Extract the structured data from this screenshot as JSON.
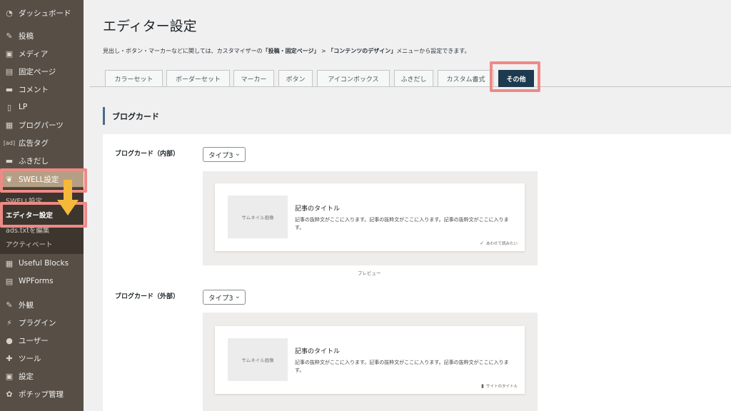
{
  "sidebar": {
    "items": [
      {
        "label": "ダッシュボード",
        "icon": "dashboard-icon",
        "glyph": "◔"
      },
      {
        "label": "投稿",
        "icon": "pin-icon",
        "glyph": "✎"
      },
      {
        "label": "メディア",
        "icon": "media-icon",
        "glyph": "▣"
      },
      {
        "label": "固定ページ",
        "icon": "page-icon",
        "glyph": "▤"
      },
      {
        "label": "コメント",
        "icon": "comment-icon",
        "glyph": "▬"
      },
      {
        "label": "LP",
        "icon": "file-icon",
        "glyph": "▯"
      },
      {
        "label": "ブログパーツ",
        "icon": "grid-icon",
        "glyph": "▦"
      },
      {
        "label": "広告タグ",
        "icon": "ad-icon",
        "glyph": "[ad]"
      },
      {
        "label": "ふきだし",
        "icon": "speech-icon",
        "glyph": "▬"
      },
      {
        "label": "SWELL設定",
        "icon": "swell-leaf-icon",
        "glyph": "❦"
      }
    ],
    "submenu": [
      "SWELL設定",
      "エディター設定",
      "ads.txtを編集",
      "アクティベート"
    ],
    "items2": [
      {
        "label": "Useful Blocks",
        "icon": "blocks-icon",
        "glyph": "▦"
      },
      {
        "label": "WPForms",
        "icon": "forms-icon",
        "glyph": "▤"
      },
      {
        "label": "外観",
        "icon": "brush-icon",
        "glyph": "✎"
      },
      {
        "label": "プラグイン",
        "icon": "plugin-icon",
        "glyph": "⚡"
      },
      {
        "label": "ユーザー",
        "icon": "user-icon",
        "glyph": "●"
      },
      {
        "label": "ツール",
        "icon": "wrench-icon",
        "glyph": "✚"
      },
      {
        "label": "設定",
        "icon": "settings-icon",
        "glyph": "▣"
      },
      {
        "label": "ポチップ管理",
        "icon": "paw-icon",
        "glyph": "✿"
      }
    ]
  },
  "page": {
    "title": "エディター設定",
    "desc_prefix": "見出し・ボタン・マーカーなどに関しては、カスタマイザーの",
    "desc_b1": "「投稿・固定ページ」",
    "desc_mid": " > ",
    "desc_b2": "「コンテンツのデザイン」",
    "desc_suffix": "メニューから設定できます。"
  },
  "tabs": [
    "カラーセット",
    "ボーダーセット",
    "マーカー",
    "ボタン",
    "アイコンボックス",
    "ふきだし",
    "カスタム書式",
    "その他"
  ],
  "section": {
    "title": "ブログカード"
  },
  "fields": {
    "internal": {
      "label": "ブログカード（内部）",
      "select": "タイプ3"
    },
    "external": {
      "label": "ブログカード（外部）",
      "select": "タイプ3"
    }
  },
  "card": {
    "thumb": "サムネイル画像",
    "title": "記事のタイトル",
    "excerpt": "記事の抜粋文がここに入ります。記事の抜粋文がここに入ります。記事の抜粋文がここに入ります。",
    "foot_internal": "あわせて読みたい",
    "foot_external": "サイトのタイトル"
  },
  "preview_caption": "プレビュー",
  "colors": {
    "sidebar": "#574f46",
    "active_tab": "#1d3a4f",
    "highlight": "#ee8a86",
    "arrow": "#f5b93a"
  }
}
